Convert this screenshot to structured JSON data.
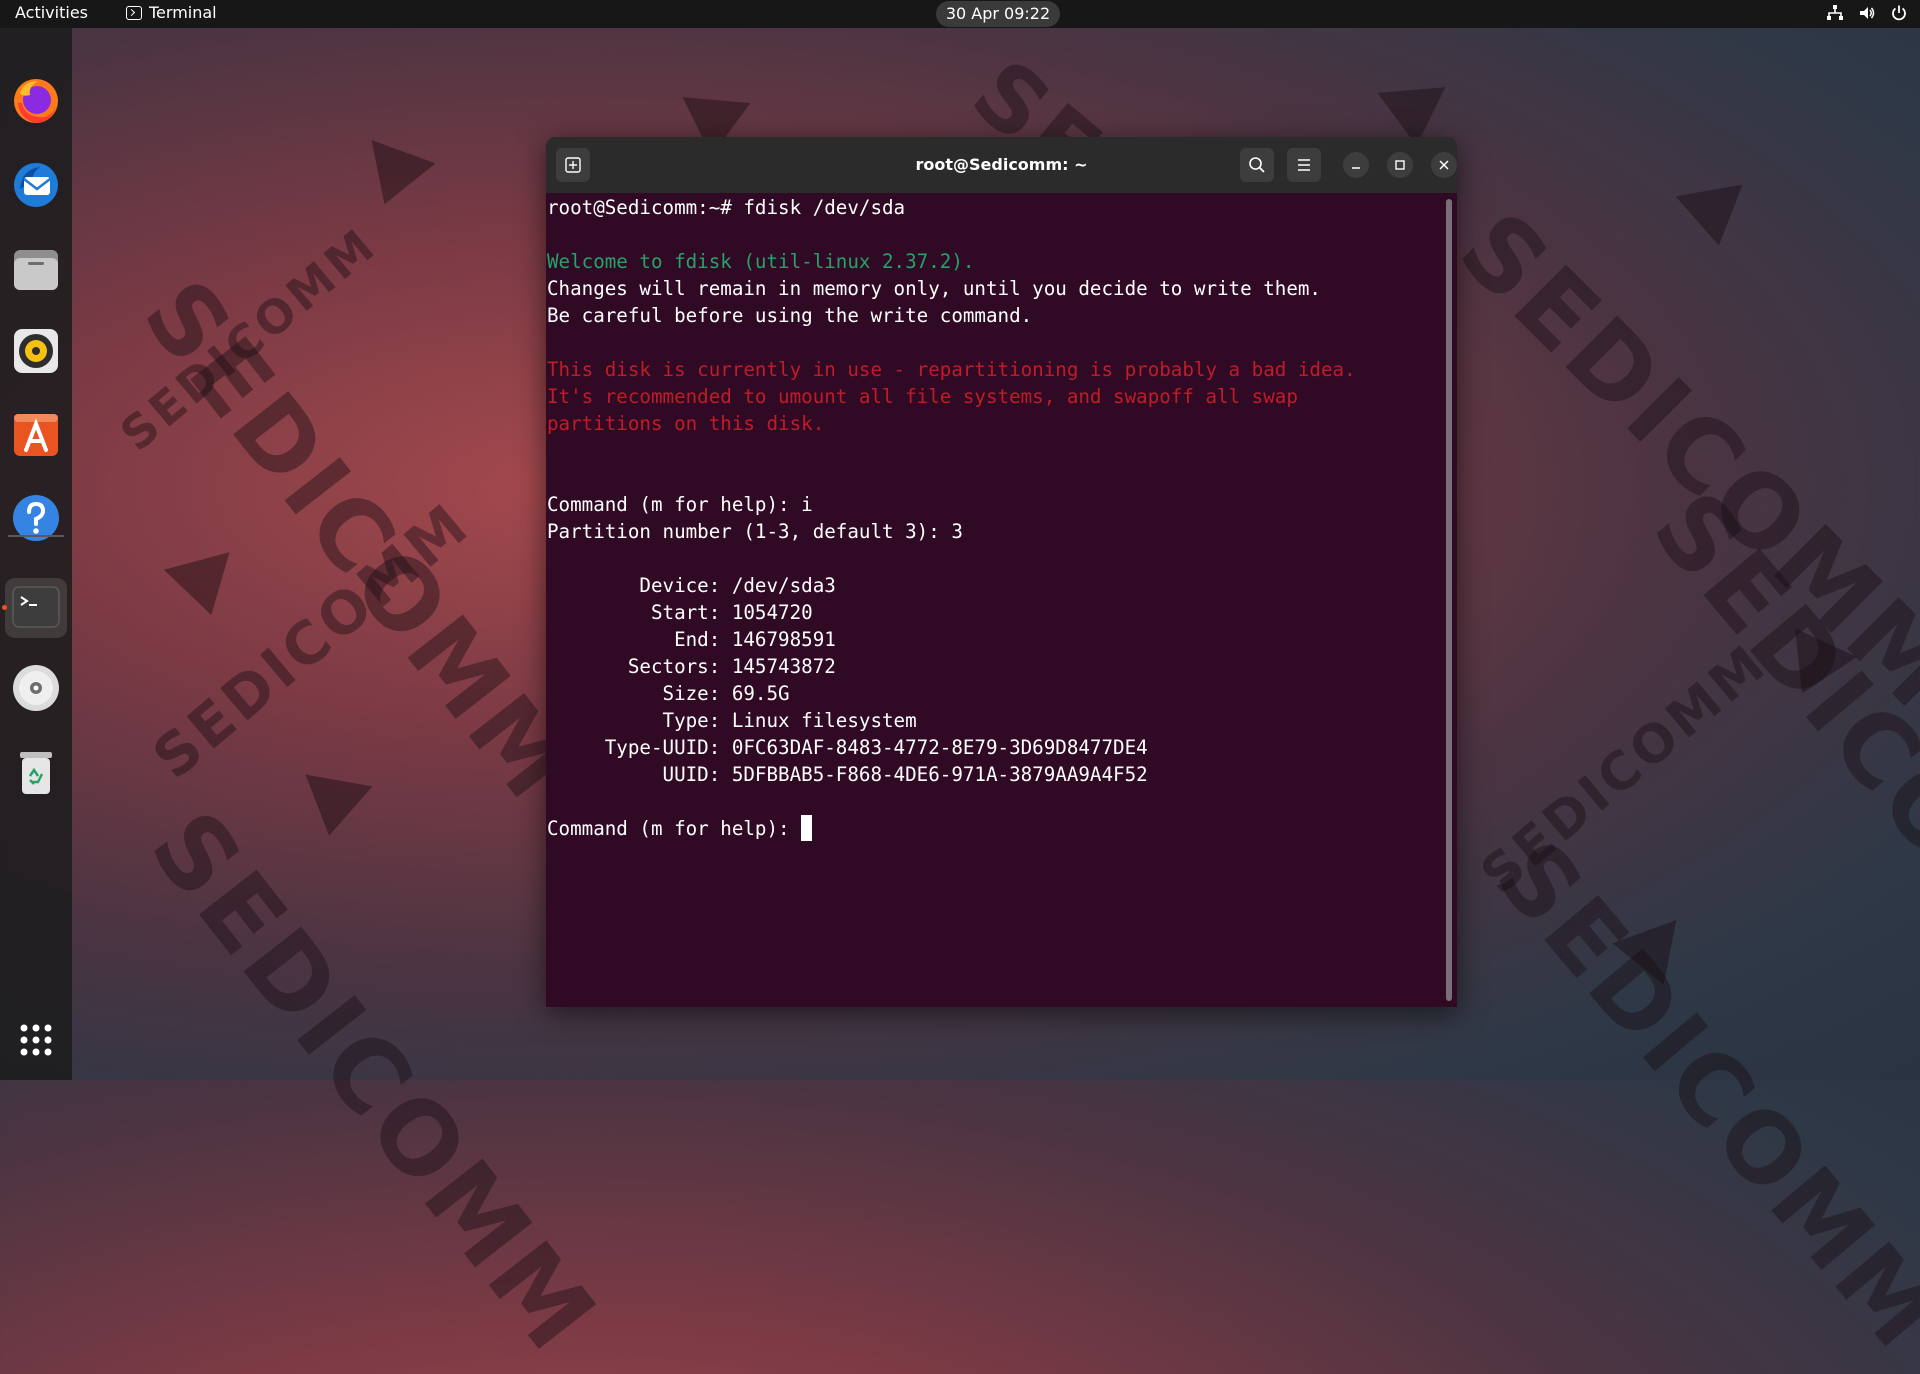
{
  "topbar": {
    "activities": "Activities",
    "app_name": "Terminal",
    "clock": "30 Apr  09:22",
    "tray_icons": [
      "network-icon",
      "volume-icon",
      "power-icon"
    ]
  },
  "dock": {
    "items": [
      {
        "name": "Firefox",
        "icon": "firefox-icon"
      },
      {
        "name": "Thunderbird",
        "icon": "thunderbird-icon"
      },
      {
        "name": "Files",
        "icon": "files-icon"
      },
      {
        "name": "Rhythmbox",
        "icon": "rhythmbox-icon"
      },
      {
        "name": "Ubuntu Software",
        "icon": "software-icon"
      },
      {
        "name": "Help",
        "icon": "help-icon"
      },
      {
        "name": "Terminal",
        "icon": "terminal-icon"
      },
      {
        "name": "Disc",
        "icon": "disc-icon"
      },
      {
        "name": "Trash",
        "icon": "trash-icon"
      },
      {
        "name": "Show Applications",
        "icon": "app-grid-icon"
      }
    ],
    "active_item": "Terminal"
  },
  "wallpaper": {
    "watermark": "SEDICOMM"
  },
  "window": {
    "title": "root@Sedicomm: ~",
    "buttons": [
      "new-tab-icon",
      "search-icon",
      "menu-icon",
      "minimize-icon",
      "maximize-icon",
      "close-icon"
    ]
  },
  "terminal": {
    "prompt_command": "root@Sedicomm:~# fdisk /dev/sda",
    "welcome": "Welcome to fdisk (util-linux 2.37.2).",
    "info_1": "Changes will remain in memory only, until you decide to write them.",
    "info_2": "Be careful before using the write command.",
    "warn_1": "This disk is currently in use - repartitioning is probably a bad idea.",
    "warn_2": "It's recommended to umount all file systems, and swapoff all swap",
    "warn_3": "partitions on this disk.",
    "cmd_1": "Command (m for help): i",
    "partition_prompt": "Partition number (1-3, default 3): 3",
    "device": "        Device: /dev/sda3",
    "start": "         Start: 1054720",
    "end": "           End: 146798591",
    "sectors": "       Sectors: 145743872",
    "size": "          Size: 69.5G",
    "type": "          Type: Linux filesystem",
    "type_uuid": "     Type-UUID: 0FC63DAF-8483-4772-8E79-3D69D8477DE4",
    "uuid": "          UUID: 5DFBBAB5-F868-4DE6-971A-3879AA9A4F52",
    "cmd_prompt": "Command (m for help): "
  },
  "colors": {
    "terminal_bg": "#300a24",
    "green": "#26a269",
    "red": "#c01c28",
    "accent": "#e95420"
  }
}
